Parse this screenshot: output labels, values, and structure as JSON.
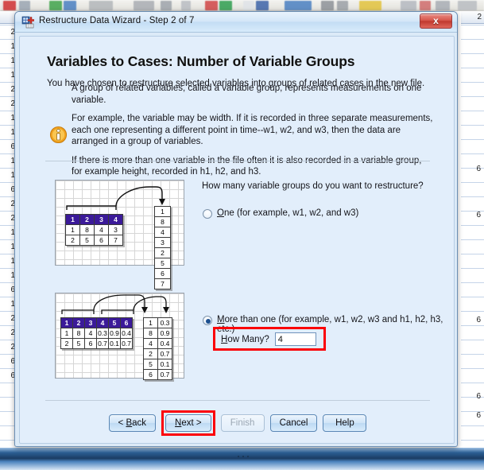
{
  "background": {
    "name": "spss-data-editor",
    "left_column_values": [
      "2",
      "1",
      "1",
      "1",
      "2",
      "2",
      "1",
      "1",
      "6",
      "1",
      "1",
      "6",
      "2",
      "2",
      "1",
      "1",
      "1",
      "1",
      "6",
      "1",
      "2",
      "2",
      "2",
      "6",
      "6"
    ],
    "right_column_header": "2",
    "right_column_values": [
      "6",
      "6",
      "6",
      "6",
      "6"
    ]
  },
  "dialog": {
    "title": "Restructure Data Wizard - Step 2 of 7",
    "title_icon": "spss-restructure-icon",
    "close_label": "x",
    "heading": "Variables to Cases: Number of Variable Groups",
    "intro": "You have chosen to restructure selected variables into groups of related cases in the new file.",
    "info_icon": "info-icon",
    "info_paragraphs": [
      "A group of related variables, called a variable group, represents measurements on one variable.",
      "For example, the variable may be width.  If it is recorded in three separate measurements, each one representing a different point in time--w1, w2, and w3, then the data are arranged in a group of variables.",
      "If there is more than one variable in the file often it is also recorded in a variable group, for example height, recorded in h1, h2, and h3."
    ],
    "question": "How many variable groups do you want to restructure?",
    "options": [
      {
        "id": "one",
        "label_prefix": "",
        "accel": "O",
        "label_rest": "ne (for example, w1, w2, and w3)",
        "selected": false
      },
      {
        "id": "more-than-one",
        "label_prefix": "",
        "accel": "M",
        "label_rest": "ore than one (for example, w1, w2, w3 and h1, h2, h3, etc.)",
        "selected": true
      }
    ],
    "how_many": {
      "accel": "H",
      "label_rest": "ow Many?",
      "value": "4",
      "highlighted": true,
      "highlight_color": "#fb0007"
    },
    "buttons": [
      {
        "id": "back",
        "label": "< Back",
        "accel_index": 2,
        "disabled": false,
        "highlighted": false
      },
      {
        "id": "next",
        "label": "Next >",
        "accel_index": 0,
        "disabled": false,
        "highlighted": true
      },
      {
        "id": "finish",
        "label": "Finish",
        "accel_index": -1,
        "disabled": true,
        "highlighted": false
      },
      {
        "id": "cancel",
        "label": "Cancel",
        "accel_index": -1,
        "disabled": false,
        "highlighted": false
      },
      {
        "id": "help",
        "label": "Help",
        "accel_index": -1,
        "disabled": false,
        "highlighted": false
      }
    ],
    "diagram_one": {
      "source_header": [
        "1",
        "2",
        "3",
        "4"
      ],
      "source_rows": [
        [
          "1",
          "8",
          "4",
          "3"
        ],
        [
          "2",
          "5",
          "6",
          "7"
        ]
      ],
      "result_column": [
        "1",
        "8",
        "4",
        "3",
        "2",
        "5",
        "6",
        "7"
      ]
    },
    "diagram_many": {
      "source_header": [
        "1",
        "2",
        "3",
        "4",
        "5",
        "6"
      ],
      "source_rows": [
        [
          "1",
          "8",
          "4",
          "0.3",
          "0.9",
          "0.4"
        ],
        [
          "2",
          "5",
          "6",
          "0.7",
          "0.1",
          "0.7"
        ]
      ],
      "result_rows": [
        [
          "1",
          "0.3"
        ],
        [
          "8",
          "0.9"
        ],
        [
          "4",
          "0.4"
        ],
        [
          "2",
          "0.7"
        ],
        [
          "5",
          "0.1"
        ],
        [
          "6",
          "0.7"
        ]
      ]
    }
  }
}
